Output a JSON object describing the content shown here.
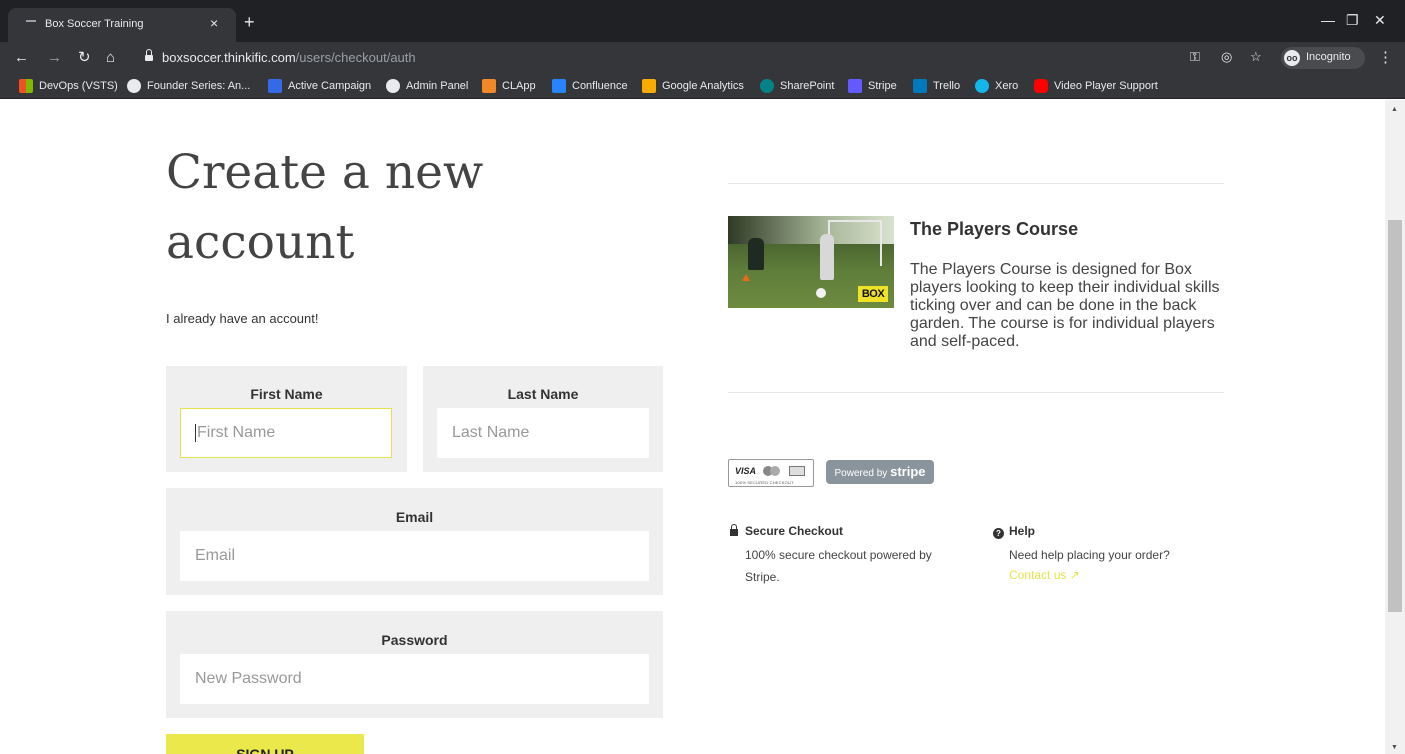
{
  "browser": {
    "tab_title": "Box Soccer Training",
    "tab_close": "×",
    "new_tab": "+",
    "url_host": "boxsoccer.thinkific.com",
    "url_path": "/users/checkout/auth",
    "incognito_label": "Incognito",
    "bookmarks": [
      {
        "label": "DevOps (VSTS)",
        "color": "#f25022"
      },
      {
        "label": "Founder Series: An...",
        "color": "#e8eaed"
      },
      {
        "label": "Active Campaign",
        "color": "#356ae6"
      },
      {
        "label": "Admin Panel",
        "color": "#e8eaed"
      },
      {
        "label": "CLApp",
        "color": "#f0882a"
      },
      {
        "label": "Confluence",
        "color": "#2684ff"
      },
      {
        "label": "Google Analytics",
        "color": "#f9ab00"
      },
      {
        "label": "SharePoint",
        "color": "#038387"
      },
      {
        "label": "Stripe",
        "color": "#635bff"
      },
      {
        "label": "Trello",
        "color": "#0079bf"
      },
      {
        "label": "Xero",
        "color": "#13b5ea"
      },
      {
        "label": "Video Player Support",
        "color": "#ff0000"
      }
    ]
  },
  "form": {
    "heading": "Create a new account",
    "login_link": "I already have an account!",
    "first_name": {
      "label": "First Name",
      "placeholder": "First Name"
    },
    "last_name": {
      "label": "Last Name",
      "placeholder": "Last Name"
    },
    "email": {
      "label": "Email",
      "placeholder": "Email"
    },
    "password": {
      "label": "Password",
      "placeholder": "New Password"
    },
    "submit_label": "SIGN UP"
  },
  "course": {
    "title": "The Players Course",
    "description": "The Players Course is designed for Box players looking to keep their individual skills ticking over and can be done in the back garden. The course is for individual players and self-paced.",
    "image_logo": "BOX"
  },
  "payment": {
    "visa_text": "VISA",
    "visa_sub": "100% SECURED CHECKOUT",
    "stripe_prefix": "Powered by ",
    "stripe_brand": "stripe"
  },
  "secure": {
    "title": "Secure Checkout",
    "text": "100% secure checkout powered by Stripe."
  },
  "help": {
    "title": "Help",
    "text": "Need help placing your order?",
    "link": "Contact us"
  },
  "colors": {
    "accent": "#eae84a",
    "link": "#e6e24d"
  }
}
